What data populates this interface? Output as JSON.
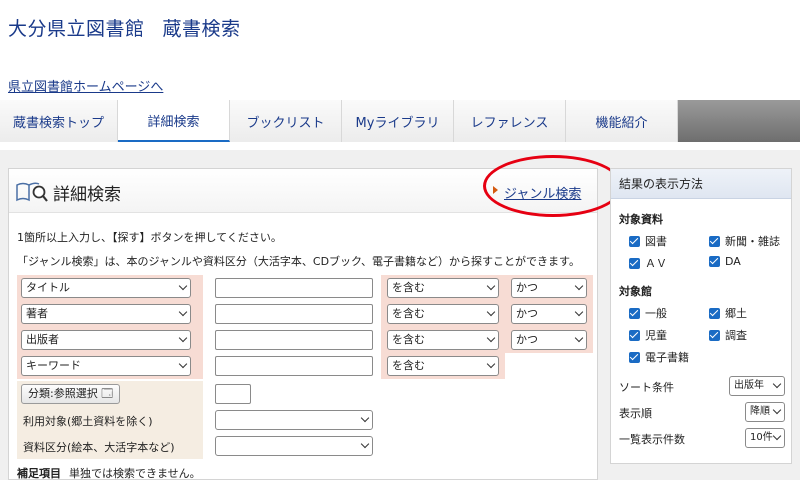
{
  "site": {
    "title_part1": "大分県立図書館",
    "title_part2": "蔵書検索",
    "home_link": "県立図書館ホームページへ"
  },
  "tabs": [
    {
      "label": "蔵書検索トップ"
    },
    {
      "label": "詳細検索"
    },
    {
      "label": "ブックリスト"
    },
    {
      "label": "Myライブラリ"
    },
    {
      "label": "レファレンス"
    },
    {
      "label": "機能紹介"
    }
  ],
  "main": {
    "title": "詳細検索",
    "genre_link": "ジャンル検索",
    "instruction1": "1箇所以上入力し、【探す】ボタンを押してください。",
    "instruction2": "「ジャンル検索」は、本のジャンルや資料区分（大活字本、CDブック、電子書籍など）から探すことができます。"
  },
  "search_rows": [
    {
      "field": "タイトル",
      "condition": "を含む",
      "join": "かつ"
    },
    {
      "field": "著者",
      "condition": "を含む",
      "join": "かつ"
    },
    {
      "field": "出版者",
      "condition": "を含む",
      "join": "かつ"
    },
    {
      "field": "キーワード",
      "condition": "を含む",
      "join": ""
    }
  ],
  "classification": {
    "button": "分類:参照選択"
  },
  "filters": {
    "target_label": "利用対象(郷土資料を除く)",
    "material_label": "資料区分(絵本、大活字本など)"
  },
  "note": {
    "label": "補足項目",
    "text": "単独では検索できません。"
  },
  "sidebar": {
    "title": "結果の表示方法",
    "material_section": "対象資料",
    "materials": [
      "図書",
      "新聞・雑誌",
      "ＡＶ",
      "DA"
    ],
    "library_section": "対象館",
    "libraries": [
      "一般",
      "郷土",
      "児童",
      "調査",
      "電子書籍"
    ],
    "sort_label": "ソート条件",
    "sort_value": "出版年",
    "order_label": "表示順",
    "order_value": "降順",
    "count_label": "一覧表示件数",
    "count_value": "10件"
  },
  "colors": {
    "link": "#1a3a8a",
    "highlight_oval": "#e60012",
    "checkbox": "#1a6bc4",
    "search_row_bg": "#f7dcd4"
  }
}
